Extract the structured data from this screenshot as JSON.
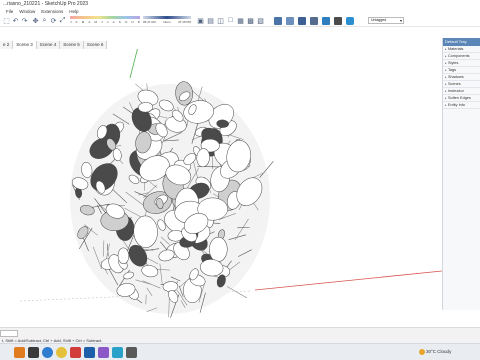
{
  "window": {
    "title": "...riasno_210221 - SketchUp Pro 2023"
  },
  "menu": [
    "File",
    "Window",
    "Extensions",
    "Help"
  ],
  "toolbar": {
    "shadow_slider_labels": [
      "J",
      "F",
      "M",
      "A",
      "M",
      "J",
      "J",
      "A",
      "S",
      "O",
      "N",
      "D"
    ],
    "time_start": "06:47 AM",
    "time_noon": "Noon",
    "time_end": "07:18 PM",
    "layer_select": "Untagged",
    "icons": [
      "select-icon",
      "undo-icon",
      "redo-icon",
      "pan-icon",
      "zoom-icon",
      "orbit-icon",
      "zoom-extents-icon",
      "xray-icon",
      "back-edges-icon",
      "wireframe-icon",
      "hidden-line-icon",
      "shaded-icon",
      "textured-icon",
      "monochrome-icon",
      "iso-view-icon",
      "top-view-icon",
      "front-view-icon",
      "right-view-icon",
      "back-view-icon",
      "left-view-icon",
      "perspective-icon",
      "section-plane-icon",
      "shadow-toggle-icon",
      "fog-icon",
      "hidden-geometry-icon",
      "component-icon",
      "group-icon",
      "style-icon",
      "geo-location-icon",
      "tag-icon"
    ]
  },
  "scenes": [
    "e 2",
    "Scene 3",
    "Scene 4",
    "Scene 5",
    "Scene 6"
  ],
  "active_scene": "Scene 3",
  "tray": {
    "title": "Default Tray",
    "items": [
      "Materials",
      "Components",
      "Styles",
      "Tags",
      "Shadows",
      "Scenes",
      "Instructor",
      "Soften Edges",
      "Entity Info"
    ]
  },
  "status": {
    "message": "t, Shift = Add/Subtract, Ctrl + Add, Shift + Ctrl = Subtract."
  },
  "taskbar": {
    "apps": [
      "start-icon",
      "file-explorer-icon",
      "edge-icon",
      "chrome-icon",
      "store-icon",
      "sketchup-icon",
      "mail-icon",
      "photos-icon",
      "settings-icon"
    ],
    "weather": "30°C Cloudy"
  },
  "colors": {
    "tray_title_bg": "#5b86b8",
    "axis_red": "#d9534f",
    "axis_green": "#4caf50",
    "axis_blue": "#3a5fcd"
  }
}
